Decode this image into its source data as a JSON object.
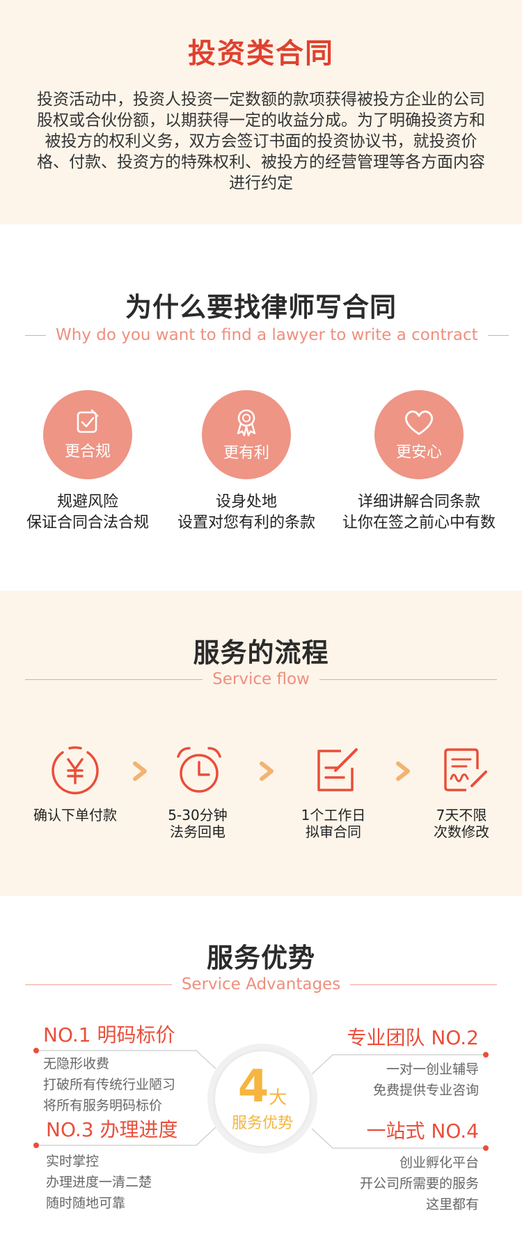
{
  "intro": {
    "title": "投资类合同",
    "text": "投资活动中，投资人投资一定数额的款项获得被投方企业的公司股权或合伙份额，以期获得一定的收益分成。为了明确投资方和被投方的权利义务，双方会签订书面的投资协议书，就投资价格、付款、投资方的特殊权利、被投方的经营管理等各方面内容进行约定"
  },
  "why": {
    "title": "为什么要找律师写合同",
    "subtitle": "Why do you want to find a lawyer to write a contract",
    "items": [
      {
        "icon": "checklist-icon",
        "label": "更合规",
        "line1": "规避风险",
        "line2": "保证合同合法合规"
      },
      {
        "icon": "medal-icon",
        "label": "更有利",
        "line1": "设身处地",
        "line2": "设置对您有利的条款"
      },
      {
        "icon": "heart-icon",
        "label": "更安心",
        "line1": "详细讲解合同条款",
        "line2": "让你在签之前心中有数"
      }
    ]
  },
  "flow": {
    "title": "服务的流程",
    "subtitle": "Service flow",
    "steps": [
      {
        "icon": "yuan-icon",
        "line1": "确认下单付款",
        "line2": ""
      },
      {
        "icon": "alarm-clock-icon",
        "line1": "5-30分钟",
        "line2": "法务回电"
      },
      {
        "icon": "edit-document-icon",
        "line1": "1个工作日",
        "line2": "拟审合同"
      },
      {
        "icon": "signature-document-icon",
        "line1": "7天不限",
        "line2": "次数修改"
      }
    ],
    "colors": {
      "accent": "#ea4e3a",
      "arrow": "#f2b372"
    }
  },
  "advantages": {
    "title": "服务优势",
    "subtitle": "Service Advantages",
    "badge": {
      "number": "4",
      "unit": "大",
      "text": "服务优势"
    },
    "items": [
      {
        "head": "NO.1 明码标价",
        "lines": [
          "无隐形收费",
          "打破所有传统行业陋习",
          "将所有服务明码标价"
        ]
      },
      {
        "head": "专业团队 NO.2",
        "lines": [
          "一对一创业辅导",
          "免费提供专业咨询"
        ]
      },
      {
        "head": "NO.3 办理进度",
        "lines": [
          "实时掌控",
          "办理进度一清二楚",
          "随时随地可靠"
        ]
      },
      {
        "head": "一站式 NO.4",
        "lines": [
          "创业孵化平台",
          "开公司所需要的服务",
          "这里都有"
        ]
      }
    ],
    "colors": {
      "head": "#ea4e3a",
      "badge": "#f5b53f"
    }
  }
}
